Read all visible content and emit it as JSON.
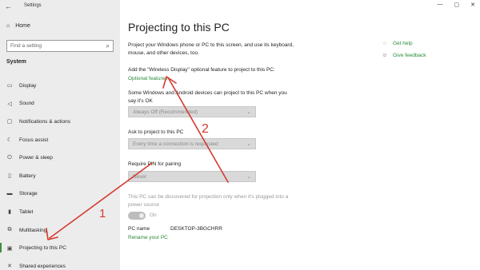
{
  "window": {
    "back_icon": "back-arrow-icon",
    "title": "Settings",
    "controls": [
      "—",
      "▢",
      "✕"
    ]
  },
  "sidebar": {
    "home_label": "Home",
    "search_placeholder": "Find a setting",
    "section_label": "System",
    "items": [
      {
        "label": "Display",
        "icon": "display-icon"
      },
      {
        "label": "Sound",
        "icon": "speaker-icon"
      },
      {
        "label": "Notifications & actions",
        "icon": "notification-icon"
      },
      {
        "label": "Focus assist",
        "icon": "moon-icon"
      },
      {
        "label": "Power & sleep",
        "icon": "power-icon"
      },
      {
        "label": "Battery",
        "icon": "battery-icon"
      },
      {
        "label": "Storage",
        "icon": "storage-icon"
      },
      {
        "label": "Tablet",
        "icon": "tablet-icon"
      },
      {
        "label": "Multitasking",
        "icon": "multitasking-icon"
      },
      {
        "label": "Projecting to this PC",
        "icon": "projector-icon",
        "active": true
      },
      {
        "label": "Shared experiences",
        "icon": "shared-icon"
      }
    ]
  },
  "main": {
    "title": "Projecting to this PC",
    "intro": "Project your Windows phone or PC to this screen, and use its keyboard, mouse, and other devices, too.",
    "wireless_text": "Add the \"Wireless Display\" optional feature to project to this PC:",
    "optional_features_link": "Optional features",
    "some_devices_text": "Some Windows and Android devices can project to this PC when you say it's OK",
    "dropdown1_value": "Always Off (Recommended)",
    "ask_label": "Ask to project to this PC",
    "dropdown2_value": "Every time a connection is requested",
    "pin_label": "Require PIN for pairing",
    "dropdown3_value": "Never",
    "discover_text": "This PC can be discovered for projection only when it's plugged into a power source",
    "toggle_state": "On",
    "pc_name_label": "PC name",
    "pc_name_value": "DESKTOP-3BGCHRR",
    "rename_link": "Rename your PC"
  },
  "help": {
    "items": [
      {
        "label": "Get help",
        "icon": "help-chat-icon"
      },
      {
        "label": "Give feedback",
        "icon": "feedback-icon"
      }
    ]
  },
  "annotations": {
    "arrow_color": "#d63a2f",
    "labels": [
      "1",
      "2"
    ]
  }
}
